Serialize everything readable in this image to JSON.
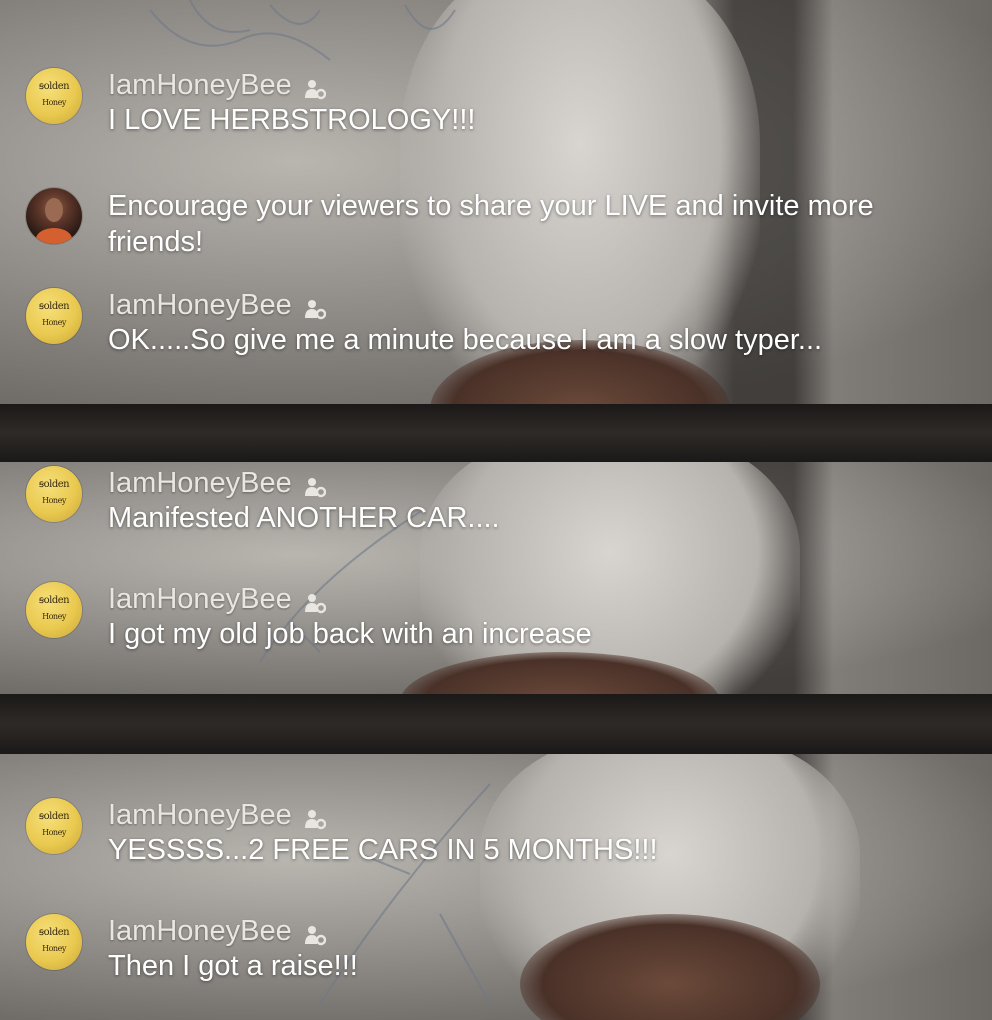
{
  "comments": [
    {
      "type": "user",
      "avatar": "golden-honey-avatar",
      "username": "IamHoneyBee",
      "badge": "moderator-icon",
      "message": "I LOVE HERBSTROLOGY!!!"
    },
    {
      "type": "system",
      "avatar": "host-photo-avatar",
      "message": "Encourage your viewers to share your LIVE and invite more friends!"
    },
    {
      "type": "user",
      "avatar": "golden-honey-avatar",
      "username": "IamHoneyBee",
      "badge": "moderator-icon",
      "message": "OK.....So give me a minute because I am a slow typer..."
    },
    {
      "type": "user",
      "avatar": "golden-honey-avatar",
      "username": "IamHoneyBee",
      "badge": "moderator-icon",
      "message": "Manifested ANOTHER CAR...."
    },
    {
      "type": "user",
      "avatar": "golden-honey-avatar",
      "username": "IamHoneyBee",
      "badge": "moderator-icon",
      "message": "I got my old job back with an increase"
    },
    {
      "type": "user",
      "avatar": "golden-honey-avatar",
      "username": "IamHoneyBee",
      "badge": "moderator-icon",
      "message": "YESSSS...2 FREE CARS IN 5 MONTHS!!!"
    },
    {
      "type": "user",
      "avatar": "golden-honey-avatar",
      "username": "IamHoneyBee",
      "badge": "moderator-icon",
      "message": "Then I got a raise!!!"
    }
  ],
  "colors": {
    "avatar_gold": "#e9c94f",
    "username_text": "#e9e6e2",
    "message_text": "#ffffff"
  }
}
